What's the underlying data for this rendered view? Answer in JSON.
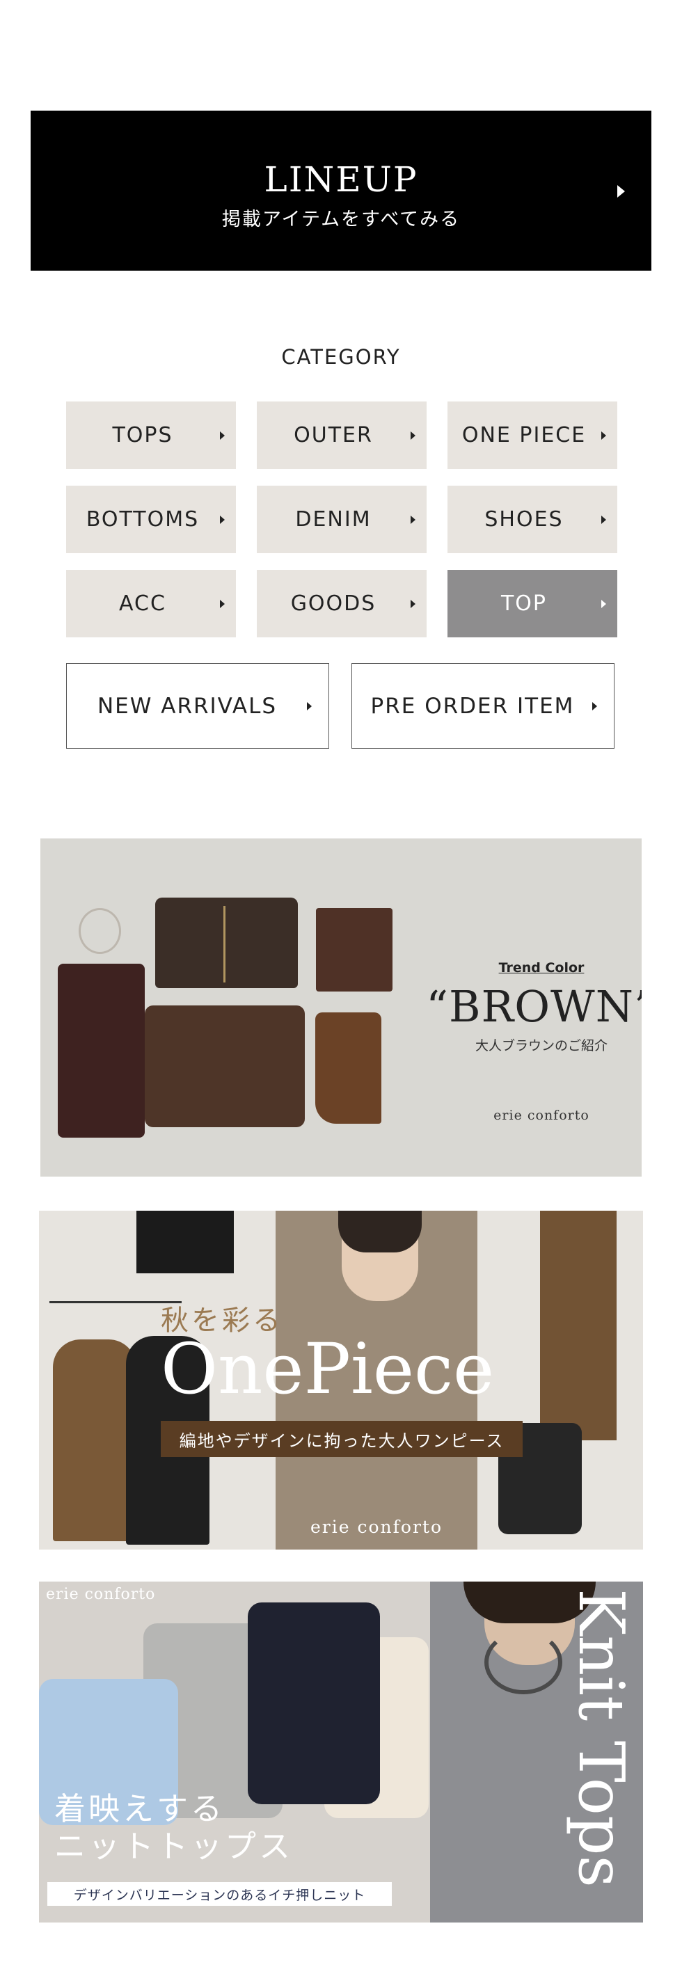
{
  "lineup": {
    "title": "LINEUP",
    "subtitle": "掲載アイテムをすべてみる"
  },
  "category": {
    "heading": "CATEGORY",
    "items": [
      {
        "label": "TOPS"
      },
      {
        "label": "OUTER"
      },
      {
        "label": "ONE PIECE"
      },
      {
        "label": "BOTTOMS"
      },
      {
        "label": "DENIM"
      },
      {
        "label": "SHOES"
      },
      {
        "label": "ACC"
      },
      {
        "label": "GOODS"
      },
      {
        "label": "TOP"
      }
    ],
    "active_item": "TOP"
  },
  "buttons": {
    "new_arrivals": "NEW ARRIVALS",
    "pre_order": "PRE ORDER ITEM"
  },
  "banners": {
    "brown": {
      "trend_label": "Trend Color",
      "headline": "“BROWN”",
      "subline": "大人ブラウンのご紹介",
      "brand": "erie conforto"
    },
    "onepiece": {
      "kicker": "秋を彩る",
      "headline": "OnePiece",
      "tagline": "編地やデザインに拘った大人ワンピース",
      "brand": "erie conforto"
    },
    "knit": {
      "brand": "erie conforto",
      "headline_line1": "着映えする",
      "headline_line2": "ニットトップス",
      "subline": "デザインバリエーションのあるイチ押しニット",
      "vertical_title": "Knit Tops"
    }
  },
  "colors": {
    "lineup_bg": "#000000",
    "category_bg": "#e8e4df",
    "category_active_bg": "#8e8d8e",
    "onepiece_tag_bg": "#5a3d23"
  }
}
